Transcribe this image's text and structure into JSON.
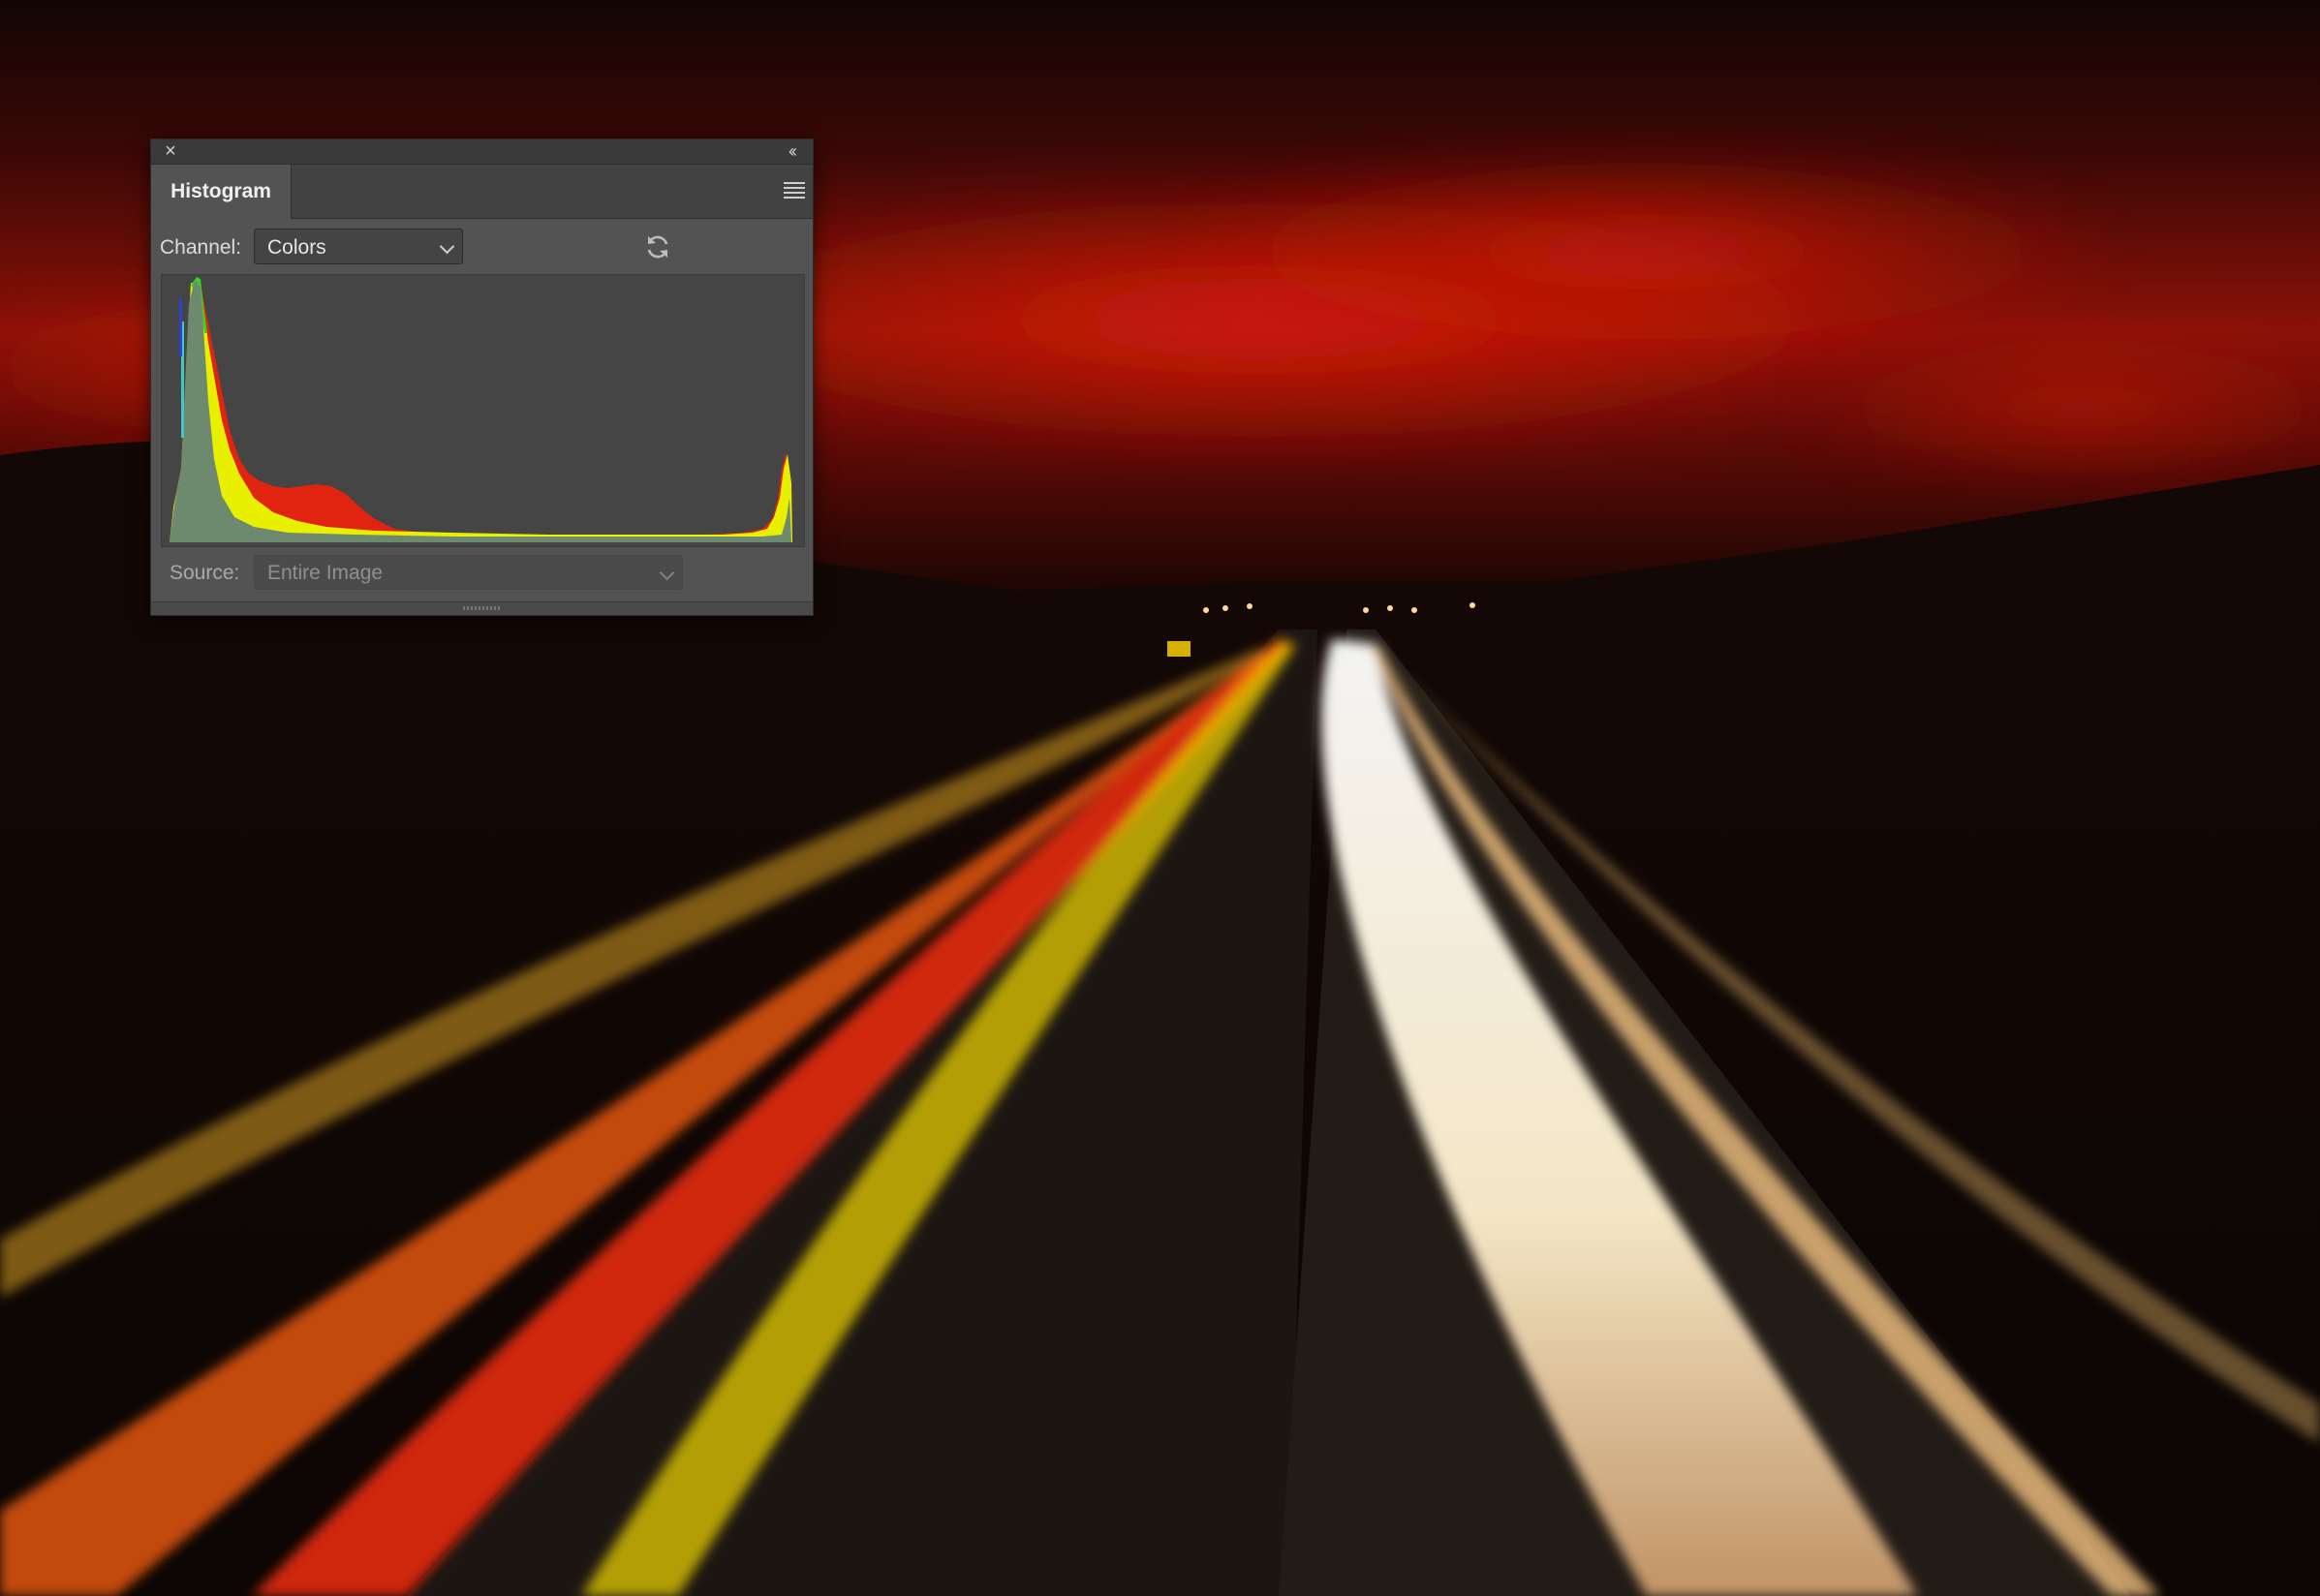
{
  "panel": {
    "close_glyph": "×",
    "collapse_glyph": "‹‹",
    "tab_label": "Histogram",
    "channel_label": "Channel:",
    "channel_value": "Colors",
    "source_label": "Source:",
    "source_value": "Entire Image",
    "icons": [
      "close-icon",
      "collapse-icon",
      "panel-menu-icon",
      "refresh-icon",
      "chevron-down-icon"
    ]
  },
  "colors": {
    "panel_bg": "#535353",
    "hist_gray": "#6e8a6e",
    "hist_red": "#e02410",
    "hist_yellow": "#e8f000",
    "hist_green": "#39d020",
    "hist_cyan": "#3fc8c8",
    "hist_blue": "#2f3fd0"
  }
}
